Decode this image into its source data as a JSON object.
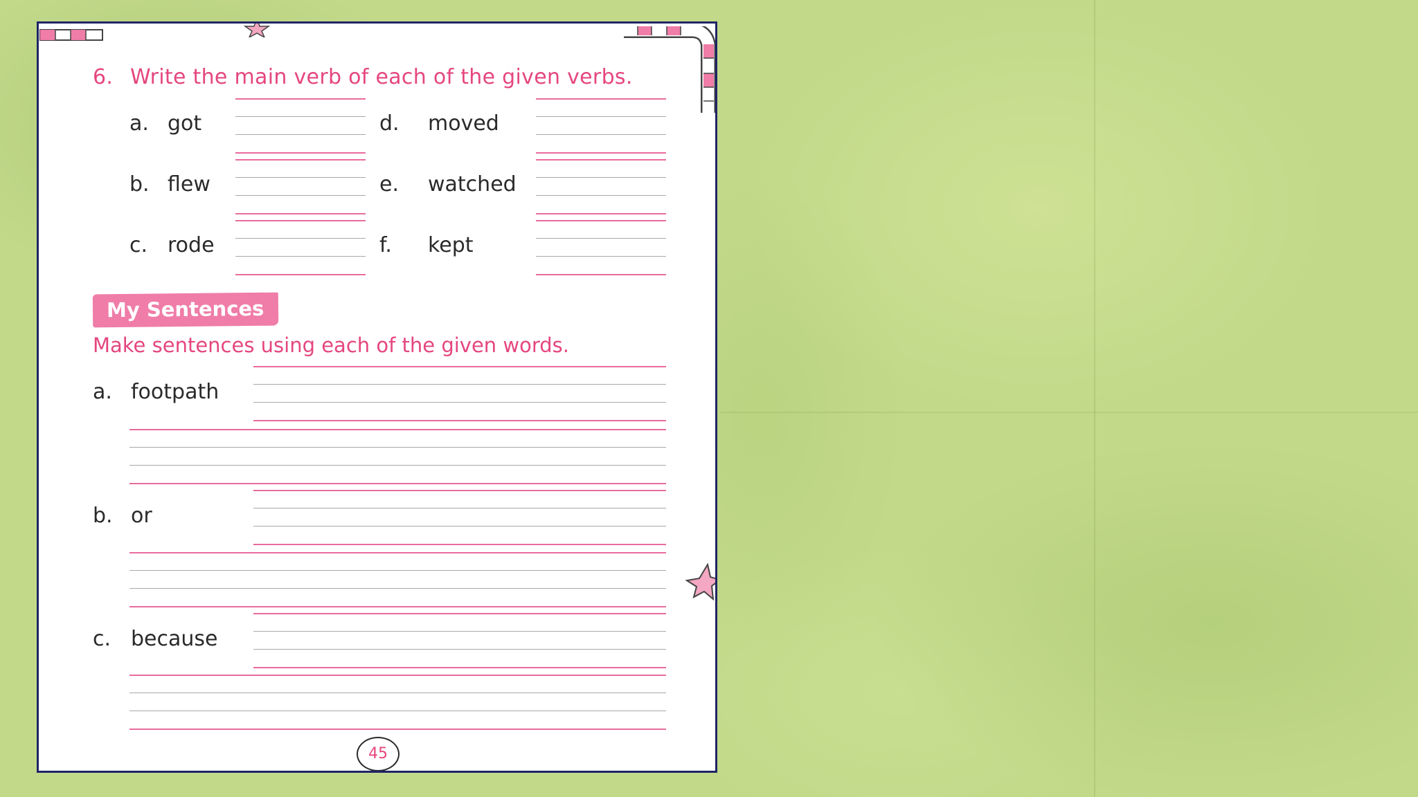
{
  "question": {
    "number": "6.",
    "text": "Write the main verb of each of the given verbs.",
    "items": [
      {
        "letter": "a.",
        "word": "got"
      },
      {
        "letter": "b.",
        "word": "flew"
      },
      {
        "letter": "c.",
        "word": "rode"
      },
      {
        "letter": "d.",
        "word": "moved"
      },
      {
        "letter": "e.",
        "word": "watched"
      },
      {
        "letter": "f.",
        "word": "kept"
      }
    ]
  },
  "my_sentences": {
    "heading": "My Sentences",
    "instruction": "Make sentences using each of the given words.",
    "items": [
      {
        "letter": "a.",
        "word": "footpath"
      },
      {
        "letter": "b.",
        "word": "or"
      },
      {
        "letter": "c.",
        "word": "because"
      }
    ]
  },
  "page_number": "45",
  "colors": {
    "accent_pink": "#e5467f",
    "tag_pink": "#ef7da7",
    "page_border": "#1f2466",
    "background_green": "#c2d98a"
  }
}
